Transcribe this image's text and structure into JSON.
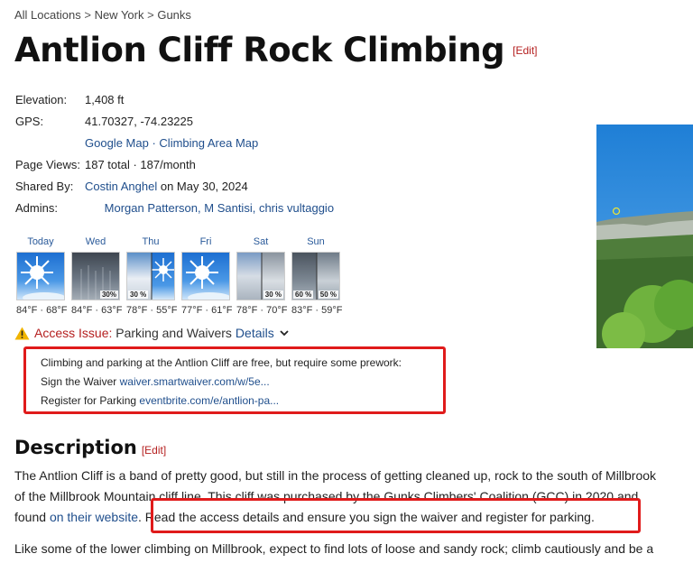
{
  "breadcrumb": {
    "items": [
      "All Locations",
      "New York",
      "Gunks"
    ],
    "separator": ">"
  },
  "title": "Antlion Cliff Rock Climbing",
  "edit_label": "[Edit]",
  "info": {
    "elevation": {
      "label": "Elevation:",
      "value": "1,408 ft"
    },
    "gps": {
      "label": "GPS:",
      "value": "41.70327, -74.23225",
      "google_map": "Google Map",
      "dot": "·",
      "climbing_map": "Climbing Area Map"
    },
    "page_views": {
      "label": "Page Views:",
      "value": "187 total · 187/month"
    },
    "shared_by": {
      "label": "Shared By:",
      "user": "Costin Anghel",
      "date": " on May 30, 2024"
    },
    "admins": {
      "label": "Admins:",
      "a1": "Morgan Patterson",
      "a2": "M Santisi",
      "a3": "chris vultaggio",
      "sep": ", "
    }
  },
  "weather": [
    {
      "day": "Today",
      "temps": "84°F · 68°F",
      "pct": ""
    },
    {
      "day": "Wed",
      "temps": "84°F · 63°F",
      "pct": "30%"
    },
    {
      "day": "Thu",
      "temps": "78°F · 55°F",
      "pct": "30 %"
    },
    {
      "day": "Fri",
      "temps": "77°F · 61°F",
      "pct": ""
    },
    {
      "day": "Sat",
      "temps": "78°F · 70°F",
      "pct": "30 %"
    },
    {
      "day": "Sun",
      "temps": "83°F · 59°F",
      "pct": "60 %",
      "pct2": "50 %"
    }
  ],
  "access": {
    "title": "Access Issue:",
    "subtitle": "Parking and Waivers",
    "details": "Details",
    "line1": "Climbing and parking at the Antlion Cliff are free, but require some prework:",
    "line2_label": "Sign the Waiver",
    "line2_link": "waiver.smartwaiver.com/w/5e...",
    "line3_label": "Register for Parking",
    "line3_link": "eventbrite.com/e/antlion-pa..."
  },
  "description": {
    "heading": "Description",
    "p1_line1": "The Antlion Cliff is a band of pretty good, but still in the process of getting cleaned up, rock to the south of Millbrook",
    "p1_line2": "of the Millbrook Mountain cliff line. This cliff was purchased by the Gunks Climbers' Coalition (GCC) in 2020 and",
    "p1_line3_pre": "found",
    "p1_line3_link": "on their website",
    "p1_line3_post": ". Read the access details and ensure you sign the waiver and register for parking.",
    "p2": "Like some of the lower climbing on Millbrook, expect to find lots of loose and sandy rock; climb cautiously and be a"
  },
  "colors": {
    "accent_red": "#e01b1b",
    "link_blue": "#1f4e8c",
    "edit_red": "#b52020"
  }
}
